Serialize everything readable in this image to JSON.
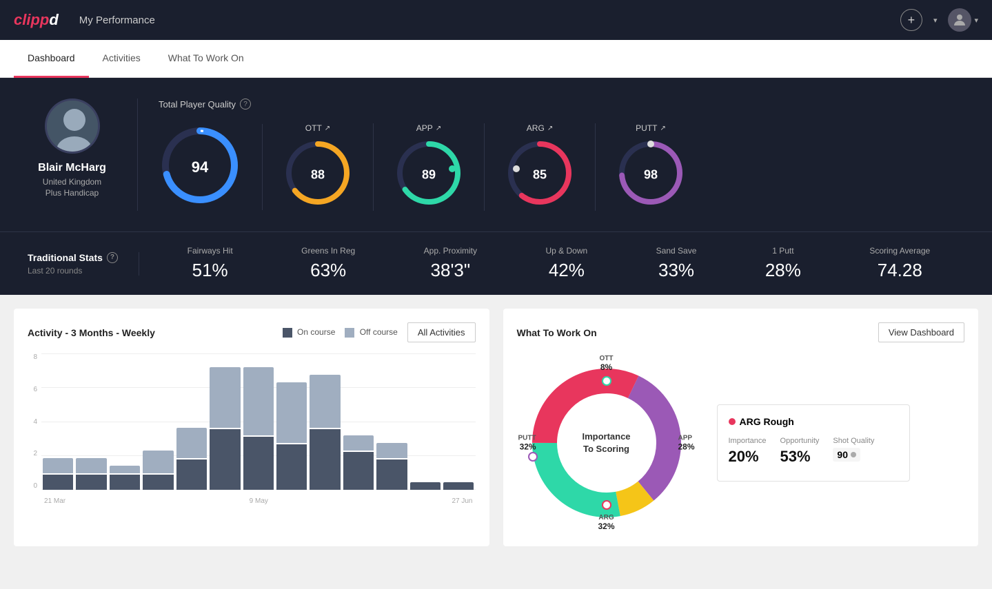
{
  "app": {
    "logo": "clippd",
    "logo_colored": "clipp",
    "logo_white": "d"
  },
  "nav": {
    "title": "My Performance",
    "add_icon": "+",
    "chevron": "▾"
  },
  "tabs": [
    {
      "id": "dashboard",
      "label": "Dashboard",
      "active": true
    },
    {
      "id": "activities",
      "label": "Activities",
      "active": false
    },
    {
      "id": "what-to-work-on",
      "label": "What To Work On",
      "active": false
    }
  ],
  "player": {
    "name": "Blair McHarg",
    "country": "United Kingdom",
    "handicap": "Plus Handicap"
  },
  "quality": {
    "title": "Total Player Quality",
    "main": {
      "value": 94,
      "color": "#3a8fff"
    },
    "metrics": [
      {
        "id": "ott",
        "label": "OTT",
        "value": 88,
        "color": "#f5a623",
        "arc_color": "#f5a623"
      },
      {
        "id": "app",
        "label": "APP",
        "value": 89,
        "color": "#2ed8a8",
        "arc_color": "#2ed8a8"
      },
      {
        "id": "arg",
        "label": "ARG",
        "value": 85,
        "color": "#e8365d",
        "arc_color": "#e8365d"
      },
      {
        "id": "putt",
        "label": "PUTT",
        "value": 98,
        "color": "#9b59b6",
        "arc_color": "#9b59b6"
      }
    ]
  },
  "traditional_stats": {
    "title": "Traditional Stats",
    "subtitle": "Last 20 rounds",
    "items": [
      {
        "label": "Fairways Hit",
        "value": "51%"
      },
      {
        "label": "Greens In Reg",
        "value": "63%"
      },
      {
        "label": "App. Proximity",
        "value": "38'3\""
      },
      {
        "label": "Up & Down",
        "value": "42%"
      },
      {
        "label": "Sand Save",
        "value": "33%"
      },
      {
        "label": "1 Putt",
        "value": "28%"
      },
      {
        "label": "Scoring Average",
        "value": "74.28"
      }
    ]
  },
  "activity_chart": {
    "title": "Activity - 3 Months - Weekly",
    "legend": [
      {
        "label": "On course",
        "color": "#4a5568"
      },
      {
        "label": "Off course",
        "color": "#a0aec0"
      }
    ],
    "button": "All Activities",
    "y_labels": [
      "8",
      "6",
      "4",
      "2",
      "0"
    ],
    "x_labels": [
      "21 Mar",
      "9 May",
      "27 Jun"
    ],
    "bars": [
      {
        "on": 1,
        "off": 1
      },
      {
        "on": 1,
        "off": 1
      },
      {
        "on": 1,
        "off": 0.5
      },
      {
        "on": 1,
        "off": 1.5
      },
      {
        "on": 2,
        "off": 2
      },
      {
        "on": 4,
        "off": 4
      },
      {
        "on": 3.5,
        "off": 4.5
      },
      {
        "on": 3,
        "off": 4
      },
      {
        "on": 4,
        "off": 3.5
      },
      {
        "on": 2.5,
        "off": 1
      },
      {
        "on": 2,
        "off": 1
      },
      {
        "on": 0.5,
        "off": 0
      },
      {
        "on": 0.5,
        "off": 0
      }
    ]
  },
  "what_to_work_on": {
    "title": "What To Work On",
    "button": "View Dashboard",
    "segments": [
      {
        "label": "OTT",
        "pct": 8,
        "color": "#f5c518"
      },
      {
        "label": "APP",
        "pct": 28,
        "color": "#2ed8a8"
      },
      {
        "label": "ARG",
        "pct": 32,
        "color": "#e8365d"
      },
      {
        "label": "PUTT",
        "pct": 32,
        "color": "#9b59b6"
      }
    ],
    "center_line1": "Importance",
    "center_line2": "To Scoring",
    "highlight_card": {
      "title": "ARG Rough",
      "dot_color": "#e8365d",
      "metrics": [
        {
          "label": "Importance",
          "value": "20%"
        },
        {
          "label": "Opportunity",
          "value": "53%"
        },
        {
          "label": "Shot Quality",
          "value": "90"
        }
      ]
    }
  }
}
